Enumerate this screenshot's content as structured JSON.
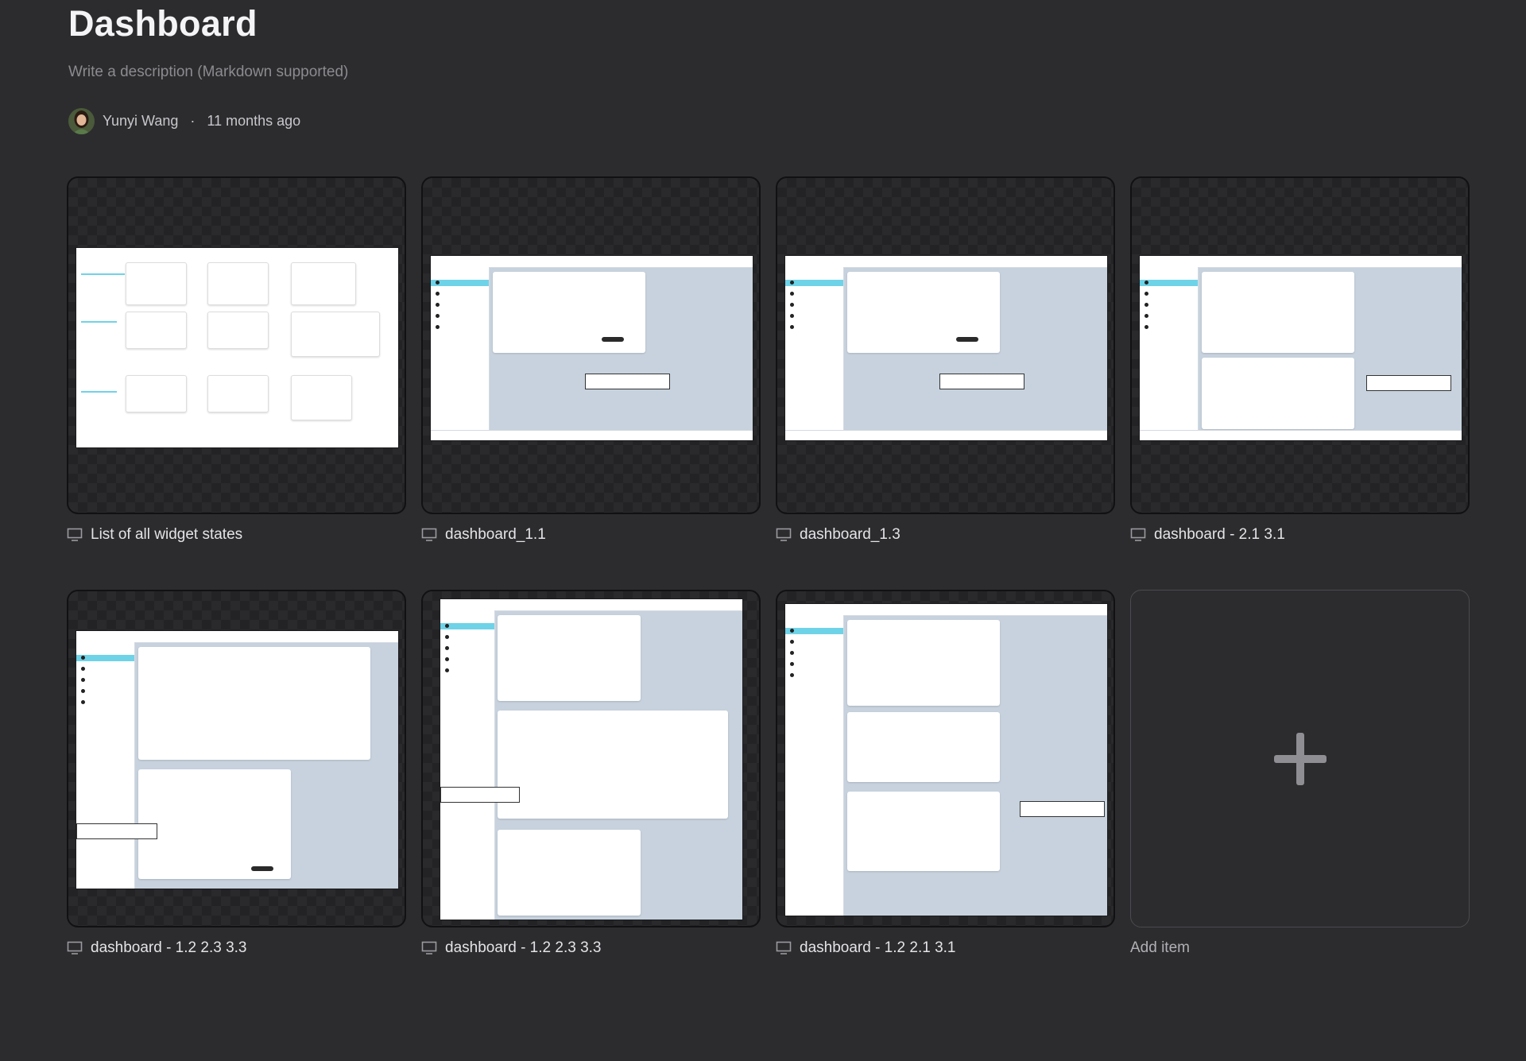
{
  "page": {
    "title": "Dashboard",
    "description_placeholder": "Write a description (Markdown supported)",
    "author": "Yunyi Wang",
    "timestamp": "11 months ago",
    "meta_sep": " · "
  },
  "items": [
    {
      "label": "List of all widget states",
      "icon": "monitor-icon"
    },
    {
      "label": "dashboard_1.1",
      "icon": "monitor-icon"
    },
    {
      "label": "dashboard_1.3",
      "icon": "monitor-icon"
    },
    {
      "label": "dashboard - 2.1 3.1",
      "icon": "monitor-icon"
    },
    {
      "label": "dashboard - 1.2 2.3 3.3",
      "icon": "monitor-icon"
    },
    {
      "label": "dashboard - 1.2 2.3 3.3",
      "icon": "monitor-icon"
    },
    {
      "label": "dashboard - 1.2 2.1 3.1",
      "icon": "monitor-icon"
    }
  ],
  "add_item": {
    "label": "Add item",
    "icon": "plus-icon"
  },
  "colors": {
    "background": "#2c2c2e",
    "accent_cyan": "#6fd3e8",
    "thumb_bg": "#c7d2de"
  }
}
